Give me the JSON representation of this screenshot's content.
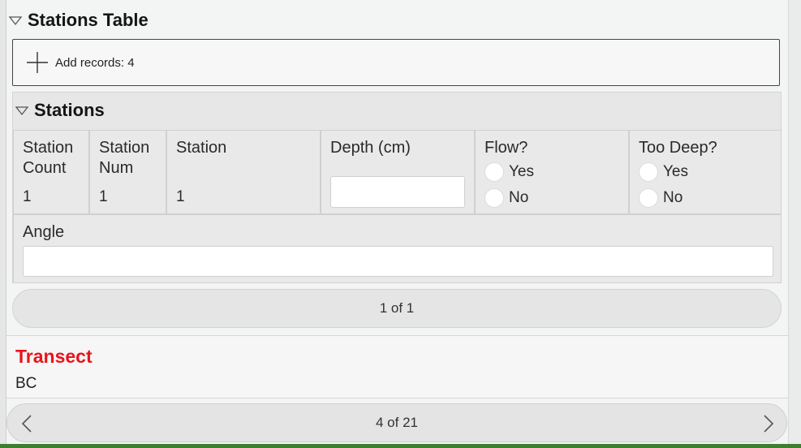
{
  "stations_table": {
    "title": "Stations Table",
    "add_records_label": "Add records: 4"
  },
  "stations": {
    "title": "Stations",
    "fields": {
      "station_count": {
        "label": "Station Count",
        "value": "1"
      },
      "station_num": {
        "label": "Station Num",
        "value": "1"
      },
      "station": {
        "label": "Station",
        "value": "1"
      },
      "depth": {
        "label": "Depth (cm)",
        "value": ""
      },
      "flow": {
        "label": "Flow?",
        "options": [
          "Yes",
          "No"
        ]
      },
      "too_deep": {
        "label": "Too Deep?",
        "options": [
          "Yes",
          "No"
        ]
      },
      "angle": {
        "label": "Angle",
        "value": ""
      }
    },
    "pager": "1 of 1"
  },
  "transect": {
    "title": "Transect",
    "value": "BC"
  },
  "record_pager": "4 of 21",
  "colors": {
    "accent_red": "#e8141b",
    "bottom_bar": "#3d7f30"
  }
}
